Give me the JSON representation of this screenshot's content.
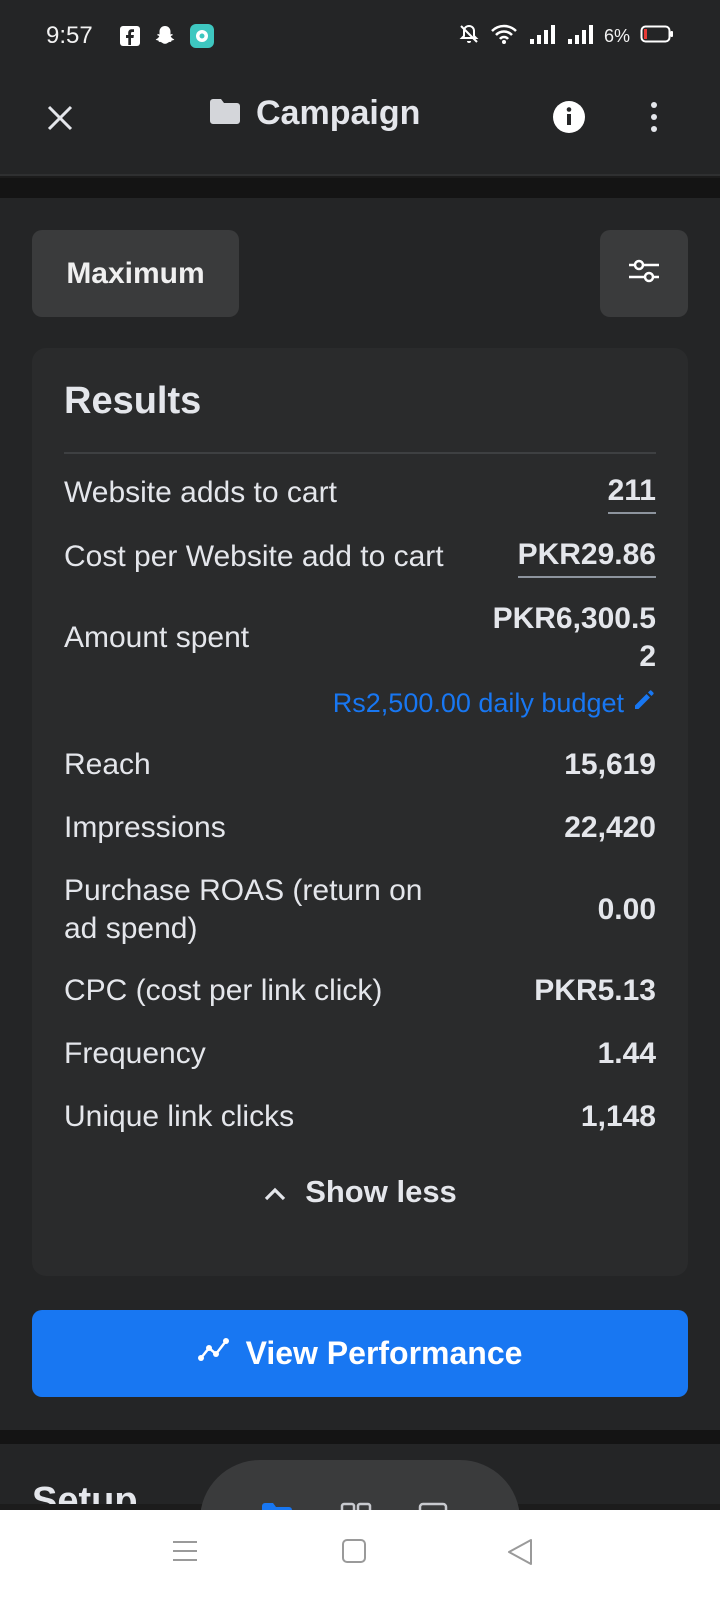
{
  "status_bar": {
    "time": "9:57",
    "battery": "6%",
    "icons": [
      "facebook-icon",
      "snapchat-icon",
      "app-icon",
      "mute-icon",
      "wifi-icon",
      "signal-icon",
      "signal-icon",
      "battery-icon"
    ]
  },
  "header": {
    "title": "Campaign",
    "icons": [
      "close-icon",
      "folder-icon",
      "info-icon",
      "more-vert-icon"
    ]
  },
  "controls": {
    "date_range_label": "Maximum",
    "filter_icon": "sliders-icon"
  },
  "results": {
    "title": "Results",
    "rows": [
      {
        "label": "Website adds to cart",
        "value": "211"
      },
      {
        "label": "Cost per Website add to cart",
        "value": "PKR29.86"
      },
      {
        "label": "Amount spent",
        "value": "PKR6,300.5 2"
      },
      {
        "label": "Reach",
        "value": "15,619"
      },
      {
        "label": "Impressions",
        "value": "22,420"
      },
      {
        "label": "Purchase ROAS (return on ad spend)",
        "value": "0.00"
      },
      {
        "label": "CPC (cost per link click)",
        "value": "PKR5.13"
      },
      {
        "label": "Frequency",
        "value": "1.44"
      },
      {
        "label": "Unique link clicks",
        "value": "1,148"
      }
    ],
    "budget_link": "Rs2,500.00 daily budget",
    "show_less": "Show less"
  },
  "actions": {
    "view_performance": "View Performance"
  },
  "setup": {
    "title": "Setup"
  },
  "colors": {
    "accent": "#1877f2",
    "background": "#242526",
    "card": "#2a2b2c"
  }
}
